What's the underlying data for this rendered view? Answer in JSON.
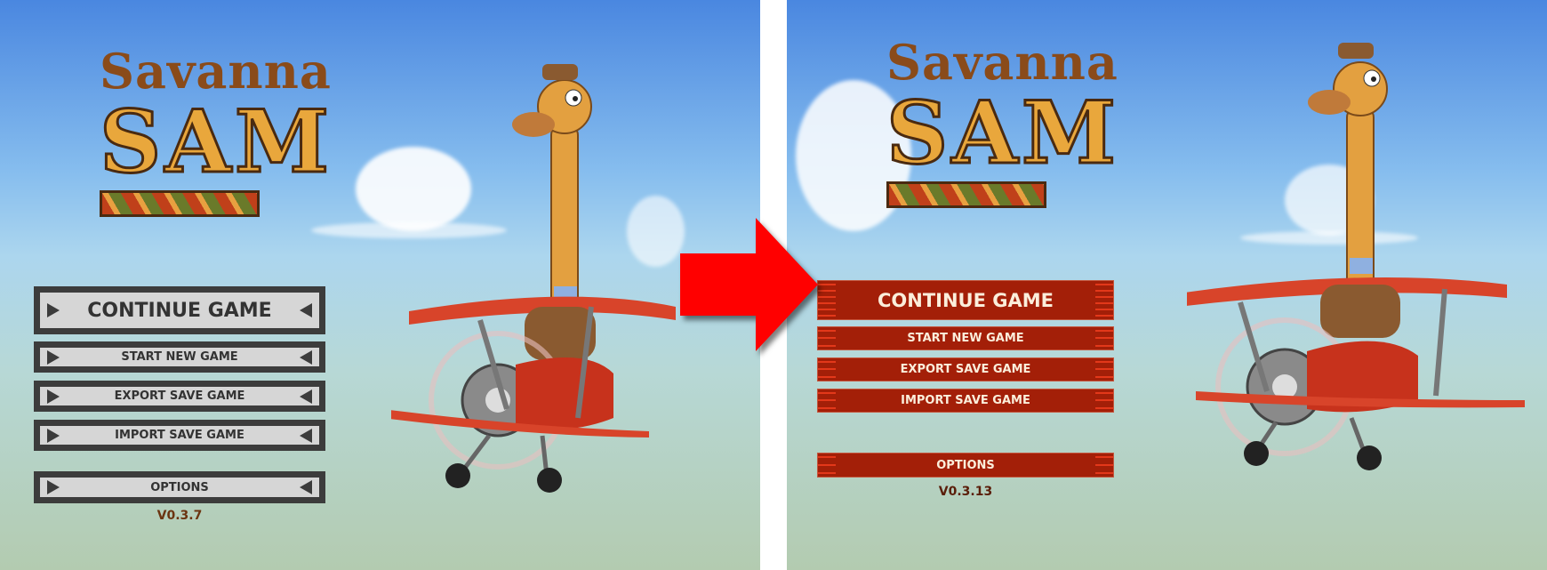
{
  "before": {
    "logo": {
      "line1": "Savanna",
      "line2": "SAM"
    },
    "menu": [
      {
        "label": "CONTINUE GAME"
      },
      {
        "label": "START NEW GAME"
      },
      {
        "label": "EXPORT SAVE GAME"
      },
      {
        "label": "IMPORT SAVE GAME"
      },
      {
        "label": "OPTIONS"
      }
    ],
    "version": "V0.3.7"
  },
  "after": {
    "logo": {
      "line1": "Savanna",
      "line2": "SAM"
    },
    "menu": [
      {
        "label": "CONTINUE GAME"
      },
      {
        "label": "START NEW GAME"
      },
      {
        "label": "EXPORT SAVE GAME"
      },
      {
        "label": "IMPORT SAVE GAME"
      },
      {
        "label": "OPTIONS"
      }
    ],
    "version": "V0.3.13"
  },
  "colors": {
    "arrow": "#ff0000",
    "old_button": "#d6d6d6",
    "new_button": "#a31f08",
    "version_old": "#6b3410",
    "version_new": "#5a1e0a"
  },
  "icons": {
    "transition": "right-arrow-icon",
    "character": "giraffe-pilot-biplane"
  }
}
